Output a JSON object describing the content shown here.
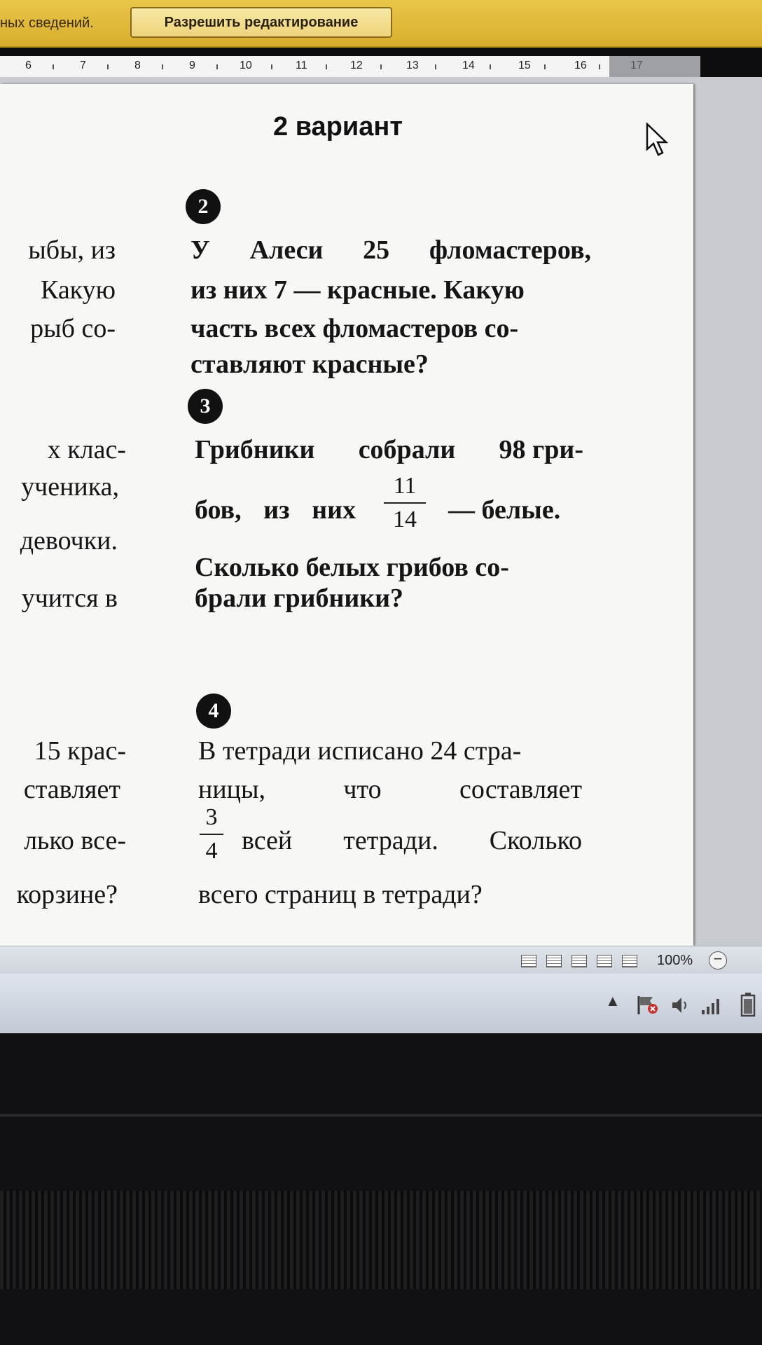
{
  "protected_view": {
    "message_fragment": "ных сведений.",
    "enable_editing_label": "Разрешить редактирование"
  },
  "ruler": {
    "labels": [
      "6",
      "7",
      "8",
      "9",
      "10",
      "11",
      "12",
      "13",
      "14",
      "15",
      "16",
      "17"
    ]
  },
  "document": {
    "title": "2 вариант",
    "left_column_lines": [
      "ыбы, из",
      "Какую",
      "рыб со-",
      "х клас-",
      "ученика,",
      "девочки.",
      "учится в",
      "15 крас-",
      "ставляет",
      "лько все-",
      "корзине?"
    ],
    "task2": {
      "number": "2",
      "line1_words": [
        "У",
        "Алеси",
        "25",
        "фломастеров,"
      ],
      "line2": "из них 7 — красные. Какую",
      "line3": "часть всех фломастеров со-",
      "line4": "ставляют красные?"
    },
    "task3": {
      "number": "3",
      "line1_words": [
        "Грибники",
        "собрали",
        "98 гри-"
      ],
      "line2_start_words": [
        "бов,",
        "из",
        "них"
      ],
      "fraction_numerator": "11",
      "fraction_denominator": "14",
      "line2_end": "— белые.",
      "line3": "Сколько белых грибов со-",
      "line4": "брали грибники?"
    },
    "task4": {
      "number": "4",
      "line1": "В тетради исписано 24 стра-",
      "line2_words": [
        "ницы,",
        "что",
        "составляет"
      ],
      "fraction_numerator": "3",
      "fraction_denominator": "4",
      "line3_words": [
        "всей",
        "тетради.",
        "Сколько"
      ],
      "line4": "всего страниц в тетради?"
    }
  },
  "statusbar": {
    "zoom": "100%",
    "zoom_minus": "−"
  }
}
